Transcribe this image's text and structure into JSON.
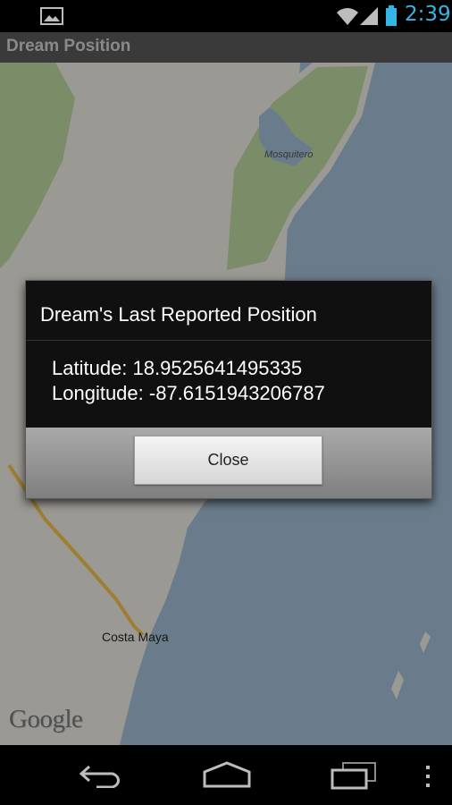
{
  "status_bar": {
    "time": "2:39",
    "icons": [
      "gallery-icon",
      "wifi-icon",
      "signal-icon",
      "battery-icon"
    ],
    "accent_color": "#33b5e5"
  },
  "app": {
    "title": "Dream Position"
  },
  "map": {
    "labels": {
      "mosquitero": "Mosquitero",
      "costa_maya": "Costa Maya"
    },
    "attribution": "Google",
    "colors": {
      "water": "#a4bfd6",
      "land": "#eeebe4",
      "vegetation": "#bcd7a0",
      "road": "#f2c44d"
    }
  },
  "dialog": {
    "title": "Dream's Last Reported Position",
    "latitude_line": "Latitude: 18.9525641495335",
    "longitude_line": "Longitude: -87.6151943206787",
    "close_label": "Close"
  },
  "nav_bar": {
    "icons": [
      "back-icon",
      "home-icon",
      "recents-icon",
      "menu-icon"
    ]
  }
}
